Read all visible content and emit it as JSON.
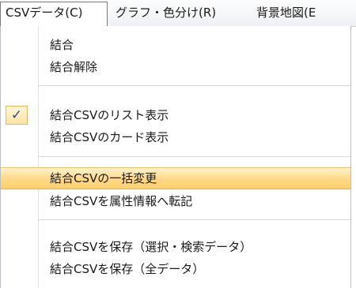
{
  "menubar": {
    "items": [
      {
        "label": "CSVデータ(C)"
      },
      {
        "label": "グラフ・色分け(R)"
      },
      {
        "label": "背景地図(E"
      }
    ]
  },
  "dropdown": {
    "items": [
      {
        "label": "結合"
      },
      {
        "label": "結合解除"
      },
      {
        "label": "結合CSVのリスト表示",
        "checked": "✓"
      },
      {
        "label": "結合CSVのカード表示"
      },
      {
        "label": "結合CSVの一括変更"
      },
      {
        "label": "結合CSVを属性情報へ転記"
      },
      {
        "label": "結合CSVを保存（選択・検索データ）"
      },
      {
        "label": "結合CSVを保存（全データ）"
      }
    ]
  }
}
